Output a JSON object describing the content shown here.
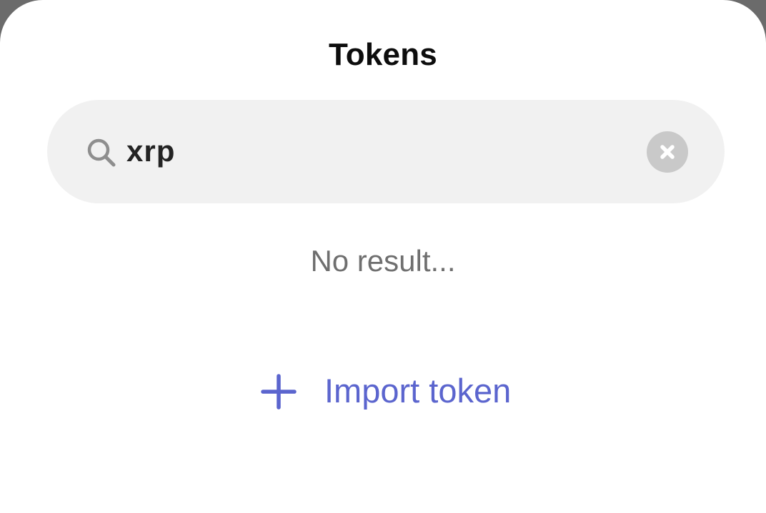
{
  "sheet": {
    "title": "Tokens"
  },
  "search": {
    "value": "xrp",
    "icon": "search-icon",
    "clear_icon": "close-icon"
  },
  "results": {
    "empty_text": "No result..."
  },
  "import": {
    "label": "Import token",
    "icon": "plus-icon"
  },
  "colors": {
    "backdrop": "#6b6b6b",
    "sheet": "#ffffff",
    "search_bg": "#f1f1f1",
    "accent": "#5b65ce",
    "muted_text": "#6f6f6f",
    "clear_bg": "#c9c9c9"
  }
}
